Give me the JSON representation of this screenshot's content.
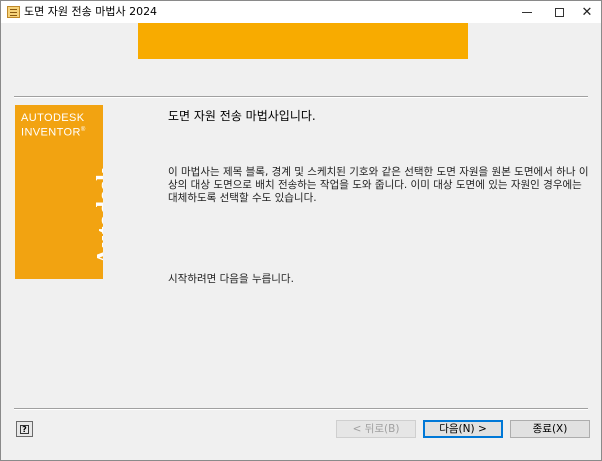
{
  "window": {
    "title": "도면 자원 전송 마법사 2024",
    "controls": {
      "minimize_icon": "minimize-icon",
      "maximize_icon": "maximize-icon",
      "close_icon": "close-icon"
    }
  },
  "brand": {
    "line1": "AUTODESK",
    "line2": "INVENTOR",
    "registered": "®",
    "vertical": "Autodesk",
    "color": "#f2a311"
  },
  "banner": {
    "color": "#f8ab00"
  },
  "main": {
    "heading": "도면 자원 전송 마법사입니다.",
    "description": "이 마법사는 제목 블록, 경계 및 스케치된 기호와 같은 선택한 도면 자원을 원본 도면에서 하나 이상의 대상 도면으로 배치 전송하는 작업을 도와 줍니다. 이미 대상 도면에 있는 자원인 경우에는 대체하도록 선택할 수도 있습니다.",
    "hint": "시작하려면 다음을 누릅니다."
  },
  "footer": {
    "help_icon": "help-icon",
    "back_label": "< 뒤로(B)",
    "next_label": "다음(N) >",
    "finish_label": "종료(X)",
    "accent": "#0078d7"
  }
}
